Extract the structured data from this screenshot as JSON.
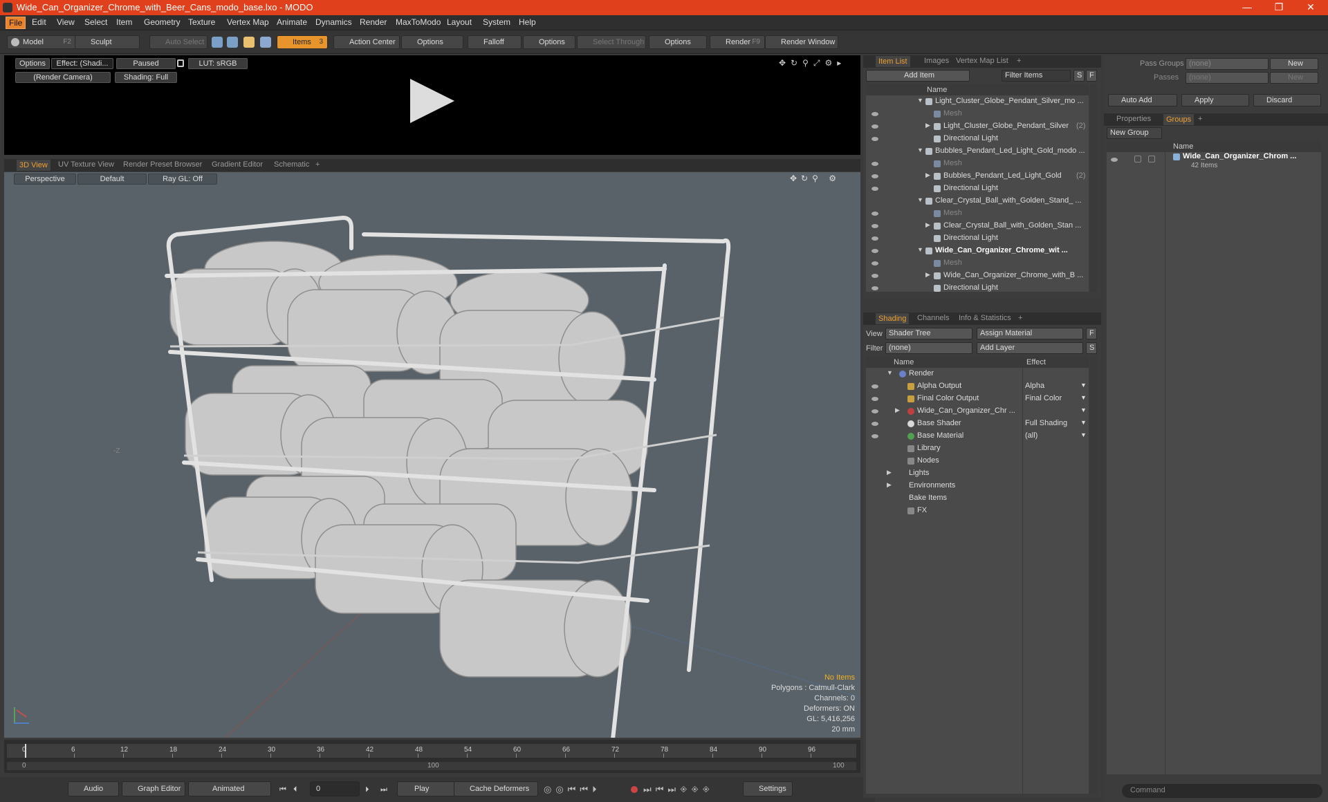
{
  "window": {
    "title": "Wide_Can_Organizer_Chrome_with_Beer_Cans_modo_base.lxo - MODO",
    "minimize": "—",
    "maximize": "❐",
    "close": "✕"
  },
  "menu": [
    "File",
    "Edit",
    "View",
    "Select",
    "Item",
    "Geometry",
    "Texture",
    "Vertex Map",
    "Animate",
    "Dynamics",
    "Render",
    "MaxToModo",
    "Layout",
    "System",
    "Help"
  ],
  "toolbar": {
    "model": "Model",
    "model_key": "F2",
    "sculpt": "Sculpt",
    "auto_select": "Auto Select",
    "items": "Items",
    "items_key": "3",
    "action_center": "Action Center",
    "options1": "Options",
    "falloff": "Falloff",
    "options2": "Options",
    "select_through": "Select Through",
    "options3": "Options",
    "render": "Render",
    "render_key": "F9",
    "render_window": "Render Window"
  },
  "render_preview": {
    "options": "Options",
    "effect": "Effect: (Shadi...",
    "paused": "Paused",
    "lut": "LUT: sRGB",
    "camera": "(Render Camera)",
    "shading": "Shading: Full"
  },
  "view_tabs": [
    "3D View",
    "UV Texture View",
    "Render Preset Browser",
    "Gradient Editor",
    "Schematic",
    "+"
  ],
  "viewport": {
    "perspective": "Perspective",
    "default": "Default",
    "raygl": "Ray GL: Off",
    "axis_label": "-Z",
    "stats": {
      "items": "No Items",
      "polygons": "Polygons : Catmull-Clark",
      "channels": "Channels: 0",
      "deformers": "Deformers: ON",
      "gl": "GL: 5,416,256",
      "size": "20 mm"
    }
  },
  "timeline": {
    "ticks": [
      "0",
      "6",
      "12",
      "18",
      "24",
      "30",
      "36",
      "42",
      "48",
      "54",
      "60",
      "66",
      "72",
      "78",
      "84",
      "90",
      "96"
    ],
    "start": "0",
    "mid": "100",
    "end": "100"
  },
  "bottombar": {
    "audio": "Audio",
    "graph_editor": "Graph Editor",
    "animated": "Animated",
    "frame": "0",
    "play": "Play",
    "cache": "Cache Deformers",
    "settings": "Settings"
  },
  "item_list": {
    "tabs": [
      "Item List",
      "Images",
      "Vertex Map List",
      "+"
    ],
    "add_item": "Add Item",
    "filter": "Filter Items",
    "s": "S",
    "f": "F",
    "col_name": "Name",
    "rows": [
      {
        "label": "Light_Cluster_Globe_Pendant_Silver_mo ...",
        "indent": 0,
        "bold": false,
        "dim": false,
        "arrow": "▼",
        "eye": false
      },
      {
        "label": "Mesh",
        "indent": 1,
        "bold": false,
        "dim": true,
        "arrow": "",
        "eye": true
      },
      {
        "label": "Light_Cluster_Globe_Pendant_Silver",
        "suffix": "(2)",
        "indent": 1,
        "bold": false,
        "dim": false,
        "arrow": "▶",
        "eye": true
      },
      {
        "label": "Directional Light",
        "indent": 1,
        "bold": false,
        "dim": false,
        "arrow": "",
        "eye": true
      },
      {
        "label": "Bubbles_Pendant_Led_Light_Gold_modo ...",
        "indent": 0,
        "bold": false,
        "dim": false,
        "arrow": "▼",
        "eye": false
      },
      {
        "label": "Mesh",
        "indent": 1,
        "bold": false,
        "dim": true,
        "arrow": "",
        "eye": true
      },
      {
        "label": "Bubbles_Pendant_Led_Light_Gold",
        "suffix": "(2)",
        "indent": 1,
        "bold": false,
        "dim": false,
        "arrow": "▶",
        "eye": true
      },
      {
        "label": "Directional Light",
        "indent": 1,
        "bold": false,
        "dim": false,
        "arrow": "",
        "eye": true
      },
      {
        "label": "Clear_Crystal_Ball_with_Golden_Stand_ ...",
        "indent": 0,
        "bold": false,
        "dim": false,
        "arrow": "▼",
        "eye": false
      },
      {
        "label": "Mesh",
        "indent": 1,
        "bold": false,
        "dim": true,
        "arrow": "",
        "eye": true
      },
      {
        "label": "Clear_Crystal_Ball_with_Golden_Stan ...",
        "indent": 1,
        "bold": false,
        "dim": false,
        "arrow": "▶",
        "eye": true
      },
      {
        "label": "Directional Light",
        "indent": 1,
        "bold": false,
        "dim": false,
        "arrow": "",
        "eye": true
      },
      {
        "label": "Wide_Can_Organizer_Chrome_wit ...",
        "indent": 0,
        "bold": true,
        "dim": false,
        "arrow": "▼",
        "eye": true
      },
      {
        "label": "Mesh",
        "indent": 1,
        "bold": false,
        "dim": true,
        "arrow": "",
        "eye": true
      },
      {
        "label": "Wide_Can_Organizer_Chrome_with_B ...",
        "indent": 1,
        "bold": false,
        "dim": false,
        "arrow": "▶",
        "eye": true
      },
      {
        "label": "Directional Light",
        "indent": 1,
        "bold": false,
        "dim": false,
        "arrow": "",
        "eye": true
      }
    ]
  },
  "shading": {
    "tabs": [
      "Shading",
      "Channels",
      "Info & Statistics",
      "+"
    ],
    "view_label": "View",
    "view_value": "Shader Tree",
    "assign": "Assign Material",
    "f": "F",
    "filter_label": "Filter",
    "filter_value": "(none)",
    "add_layer": "Add Layer",
    "s": "S",
    "col_name": "Name",
    "col_effect": "Effect",
    "rows": [
      {
        "label": "Render",
        "effect": "",
        "indent": 0,
        "arrow": "▼",
        "icon": "render",
        "eye": false
      },
      {
        "label": "Alpha Output",
        "effect": "Alpha",
        "indent": 1,
        "arrow": "",
        "icon": "output",
        "eye": true
      },
      {
        "label": "Final Color Output",
        "effect": "Final Color",
        "indent": 1,
        "arrow": "",
        "icon": "output",
        "eye": true
      },
      {
        "label": "Wide_Can_Organizer_Chr ...",
        "effect": "",
        "indent": 1,
        "arrow": "▶",
        "icon": "material-red",
        "eye": true
      },
      {
        "label": "Base Shader",
        "effect": "Full Shading",
        "indent": 1,
        "arrow": "",
        "icon": "shader",
        "eye": true
      },
      {
        "label": "Base Material",
        "effect": "(all)",
        "indent": 1,
        "arrow": "",
        "icon": "material-green",
        "eye": true
      },
      {
        "label": "Library",
        "effect": "",
        "indent": 1,
        "arrow": "",
        "icon": "folder",
        "eye": false
      },
      {
        "label": "Nodes",
        "effect": "",
        "indent": 1,
        "arrow": "",
        "icon": "folder",
        "eye": false
      },
      {
        "label": "Lights",
        "effect": "",
        "indent": 0,
        "arrow": "▶",
        "icon": "",
        "eye": false
      },
      {
        "label": "Environments",
        "effect": "",
        "indent": 0,
        "arrow": "▶",
        "icon": "",
        "eye": false
      },
      {
        "label": "Bake Items",
        "effect": "",
        "indent": 0,
        "arrow": "",
        "icon": "",
        "eye": false
      },
      {
        "label": "FX",
        "effect": "",
        "indent": 1,
        "arrow": "",
        "icon": "fx",
        "eye": false
      }
    ]
  },
  "groups": {
    "pass_groups_label": "Pass Groups",
    "pass_groups_value": "(none)",
    "new": "New",
    "passes_label": "Passes",
    "passes_value": "(none)",
    "new2": "New",
    "auto_add": "Auto Add",
    "apply": "Apply",
    "discard": "Discard",
    "tabs": [
      "Properties",
      "Groups",
      "+"
    ],
    "new_group": "New Group",
    "col_name": "Name",
    "item_name": "Wide_Can_Organizer_Chrom ...",
    "item_count": "42 Items",
    "command_placeholder": "Command"
  },
  "colors": {
    "accent": "#e8942c",
    "titlebar": "#e0401c",
    "viewport": "#596269"
  }
}
